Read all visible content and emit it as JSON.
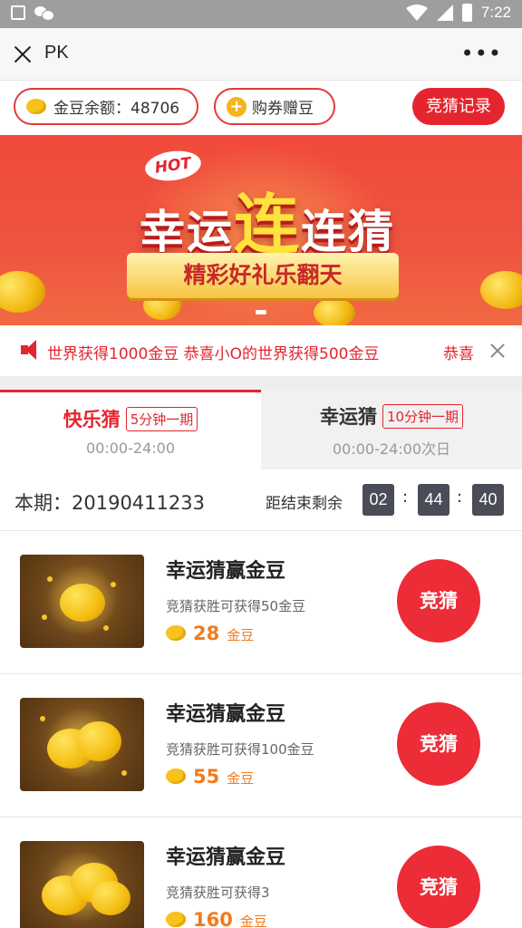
{
  "status_bar": {
    "time": "7:22"
  },
  "title_bar": {
    "title": "PK"
  },
  "actions": {
    "balance_label": "金豆余额：48706",
    "coupon_label": "购券赠豆",
    "record_label": "竞猜记录"
  },
  "banner": {
    "hot": "HOT",
    "title_prefix": "幸运",
    "title_big": "连",
    "title_suffix": "连猜",
    "subtitle": "精彩好礼乐翻天"
  },
  "notice": {
    "text": "世界获得1000金豆 恭喜小O的世界获得500金豆",
    "tail": "恭喜"
  },
  "tabs": [
    {
      "name": "快乐猜",
      "badge": "5分钟一期",
      "time": "00:00-24:00",
      "active": true
    },
    {
      "name": "幸运猜",
      "badge": "10分钟一期",
      "time": "00:00-24:00次日",
      "active": false
    }
  ],
  "period": {
    "label": "本期：20190411233",
    "countdown_label": "距结束剩余",
    "hours": "02",
    "minutes": "44",
    "seconds": "40",
    "sep": ":"
  },
  "products": [
    {
      "title": "幸运猜赢金豆",
      "desc": "竞猜获胜可获得50金豆",
      "price": "28",
      "unit": "金豆",
      "button": "竞猜"
    },
    {
      "title": "幸运猜赢金豆",
      "desc": "竞猜获胜可获得100金豆",
      "price": "55",
      "unit": "金豆",
      "button": "竞猜"
    },
    {
      "title": "幸运猜赢金豆",
      "desc": "竞猜获胜可获得3",
      "price": "160",
      "unit": "金豆",
      "button": "竞猜"
    }
  ],
  "colors": {
    "accent": "#e4252f",
    "price": "#f27b1d",
    "timer_box": "#4a4c57"
  }
}
